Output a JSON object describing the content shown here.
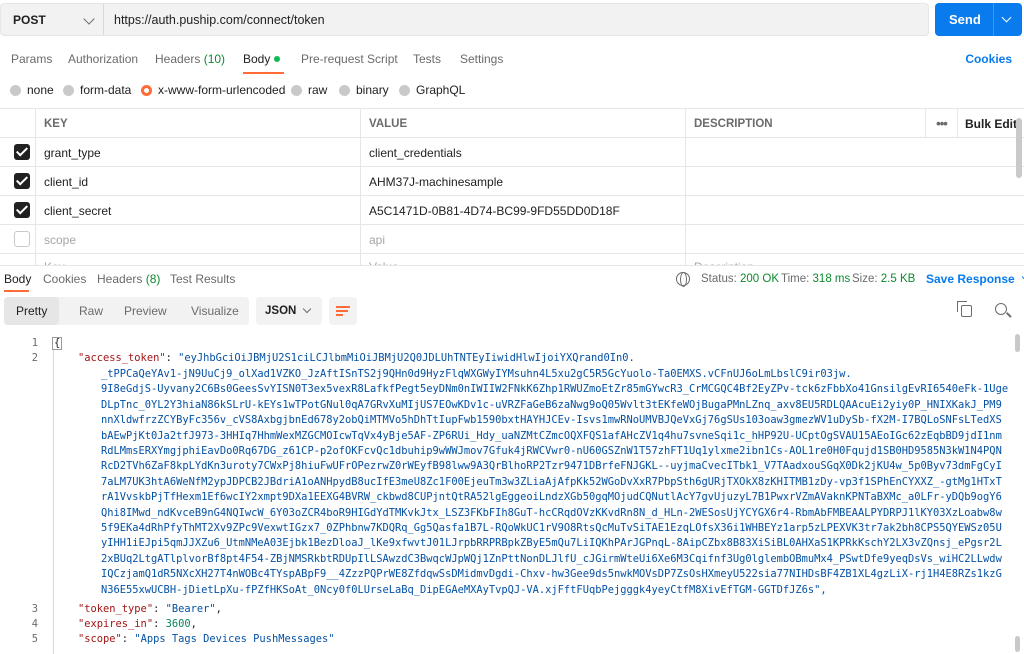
{
  "request": {
    "method": "POST",
    "url": "https://auth.puship.com/connect/token",
    "send_label": "Send"
  },
  "request_tabs": [
    {
      "label": "Params",
      "count": ""
    },
    {
      "label": "Authorization",
      "count": ""
    },
    {
      "label": "Headers",
      "count": "(10)"
    },
    {
      "label": "Body",
      "count": ""
    },
    {
      "label": "Pre-request Script",
      "count": ""
    },
    {
      "label": "Tests",
      "count": ""
    },
    {
      "label": "Settings",
      "count": ""
    }
  ],
  "cookies_label": "Cookies",
  "body_types": [
    "none",
    "form-data",
    "x-www-form-urlencoded",
    "raw",
    "binary",
    "GraphQL"
  ],
  "body_type_selected": "x-www-form-urlencoded",
  "params_table": {
    "headers": {
      "key": "KEY",
      "value": "VALUE",
      "description": "DESCRIPTION",
      "more": "•••",
      "bulk_edit": "Bulk Edit"
    },
    "rows": [
      {
        "checked": true,
        "key": "grant_type",
        "value": "client_credentials",
        "description": ""
      },
      {
        "checked": true,
        "key": "client_id",
        "value": "AHM37J-machinesample",
        "description": ""
      },
      {
        "checked": true,
        "key": "client_secret",
        "value": "A5C1471D-0B81-4D74-BC99-9FD55DD0D18F",
        "description": ""
      },
      {
        "checked": false,
        "key": "scope",
        "value": "api",
        "description": ""
      }
    ],
    "new_row_placeholders": {
      "key": "Key",
      "value": "Value",
      "description": "Description"
    }
  },
  "response_tabs": [
    {
      "label": "Body",
      "count": ""
    },
    {
      "label": "Cookies",
      "count": ""
    },
    {
      "label": "Headers",
      "count": "(8)"
    },
    {
      "label": "Test Results",
      "count": ""
    }
  ],
  "response_status": {
    "status_label": "Status:",
    "status_value": "200 OK",
    "time_label": "Time:",
    "time_value": "318 ms",
    "size_label": "Size:",
    "size_value": "2.5 KB",
    "save_label": "Save Response"
  },
  "view_modes": [
    "Pretty",
    "Raw",
    "Preview",
    "Visualize"
  ],
  "view_mode_selected": "Pretty",
  "format": "JSON",
  "code": {
    "line_numbers": [
      "1",
      "2",
      "3",
      "4",
      "5"
    ],
    "open_brace": "{",
    "access_token_key": "\"access_token\"",
    "token_first_line": "\"eyJhbGciOiJBMjU2S1ciLCJlbmMiOiJBMjU2Q0JDLUhTNTEyIiwidHlwIjoiYXQrand0In0.",
    "token_lines": [
      "_tPPCaQeYAv1-jN9UuCj9_olXad1VZKO_JzAftISnTS2j9QHn0d9HyzFlqWXGWyIYMsuhn4L5xu2gC5R5GcYuolo-Ta0EMXS.vCFnUJ6oLmLbslC9ir03jw.",
      "9I8eGdjS-Uyvany2C6Bs0GeesSvYISN0T3ex5vexR8LafkfPegt5eyDNm0nIWIIW2FNkK6Zhp1RWUZmoEtZr85mGYwcR3_CrMCGQC4Bf2EyZPv-tck6zFbbXo41GnsilgEvRI6540eFk-1Uge",
      "DLpTnc_0YL2Y3hiaN86kSLrU-kEYs1wTPotGNul0qA7GRvXuMIjUS7EOwKDv1c-uVRZFaGeB6zaNwg9oQ05Wvlt3tEKfeWOjBugaPMnLZnq_axv8EU5RDLQAAcuEi2yiy0P_HNIXKakJ_PM9",
      "nnXldwfrzZCYByFc356v_cVS8AxbgjbnEd678y2obQiMTMVo5hDhTtIupFwb1590bxtHAYHJCEv-Isvs1mwRNoUMVBJQeVxGj76gSUs103oaw3gmezWV1uDySb-fX2M-I7BQLoSNFsLTedXS",
      "bAEwPjKt0Ja2tfJ973-3HHIq7HhmWexMZGCMOIcwTqVx4yBje5AF-ZP6RUi_Hdy_uaNZMtCZmcOQXFQS1afAHcZV1q4hu7svneSqi1c_hHP92U-UCptOgSVAU15AEoIGc62zEqbBD9jdI1nm",
      "RdLMmsERXYmgjphiEavDo0Rq67DG_z61CP-p2ofOKFcvQc1dbuhip9wWWJmov7Gfuk4jRWCVwr0-nU60GSZnW1T57zhFT1Uq1ylxme2ibn1Cs-AOL1re0H0Fqujd1SB0HD9585N3kW1N4PQN",
      "RcD2TVh6ZaF8kpLYdKn3uroty7CWxPj8hiuFwUFrOPezrwZ0rWEyfB98lww9A3QrBlhoRP2Tzr9471DBrfeFNJGKL--uyjmaCvecITbk1_V7TAadxouSGqX0Dk2jKU4w_5p0Byv73dmFgCyI",
      "7aLM7UK3htA6WeNfM2ypJDPCB2JBdriA1oANHpydB8ucIfE3meU8Zc1F00EjeuTm3w3ZLiaAjAfpKk52WGoDvXxR7PbpSth6gURjTXOkX8zKHITMB1zDy-vp3f1SPhEnCYXXZ_-gtMg1HTxT",
      "rA1VvskbPjTfHexm1Ef6wcIY2xmpt9DXa1EEXG4BVRW_ckbwd8CUPjntQtRA52lgEggeoiLndzXGb50gqMOjudCQNutlAcY7gvUjuzyL7B1PwxrVZmAVaknKPNTaBXMc_a0LFr-yDQb9ogY6",
      "Qhi8IMwd_ndKvceB9nG4NQIwcW_6Y03oZCR4boR9HIGdYdTMKvkJtx_LSZ3FKbFIh8GuT-hcCRqdOVzKKvdRn8N_d_HLn-2WESosUjYCYGX6r4-RbmAbFMBEAALPYDRPJ1lKY03XzLoabw8w",
      "5f9EKa4dRhPfyThMT2Xv9ZPc9VexwtIGzx7_0ZPhbnw7KDQRq_Gg5Qasfa1B7L-RQoWkUC1rV9O8RtsQcMuTvSiTAE1EzqLOfsX36i1WHBEYz1arp5zLPEXVK3tr7ak2bh8CPS5QYEWSz05U",
      "yIHH1iEJpi5qmJJXZu6_UtmNMeA03Ejbk1BezDloaJ_lKe9xfwvtJ01LJrpbRRPRBpkZByE5mQu7LiIQKhPArJGPnqL-8AipCZbx8B83XiSiBL0AHXaS1KPRkKschY2LX3vZQnsj_ePgsr2L",
      "2xBUq2LtgATlplvorBf8pt4F54-ZBjNMSRkbtRDUpIlLSAwzdC3BwqcWJpWQj1ZnPttNonDLJlfU_cJGirmWteUi6Xe6M3Cqifnf3Ug0lglembOBmuMx4_PSwtDfe9yeqDsVs_wiHC2LLwdw",
      "IQCzjamQ1dR5NXcXH27T4nWOBc4TYspABpF9__4ZzzPQPrWE8ZfdqwSsDMidmvDgdi-Chxv-hw3Gee9ds5nwkMOVsDP7ZsOsHXmeyU522sia77NIHDsBF4ZB1XL4gzLiX-rj1H4E8RZs1kzG",
      "N36E55xwUCBH-jDietLpXu-fPZfHKSoAt_0Ncy0f0LUrseLaBq_DipEGAeMXAyTvpQJ-VA.xjFftFUqbPejgggk4yeyCtfM8XivEfTGM-GGTDfJZ6s\","
    ],
    "token_type_key": "\"token_type\"",
    "token_type_value": "\"Bearer\"",
    "expires_in_key": "\"expires_in\"",
    "expires_in_value": "3600",
    "scope_key": "\"scope\"",
    "scope_value": "\"Apps Tags Devices PushMessages\""
  }
}
